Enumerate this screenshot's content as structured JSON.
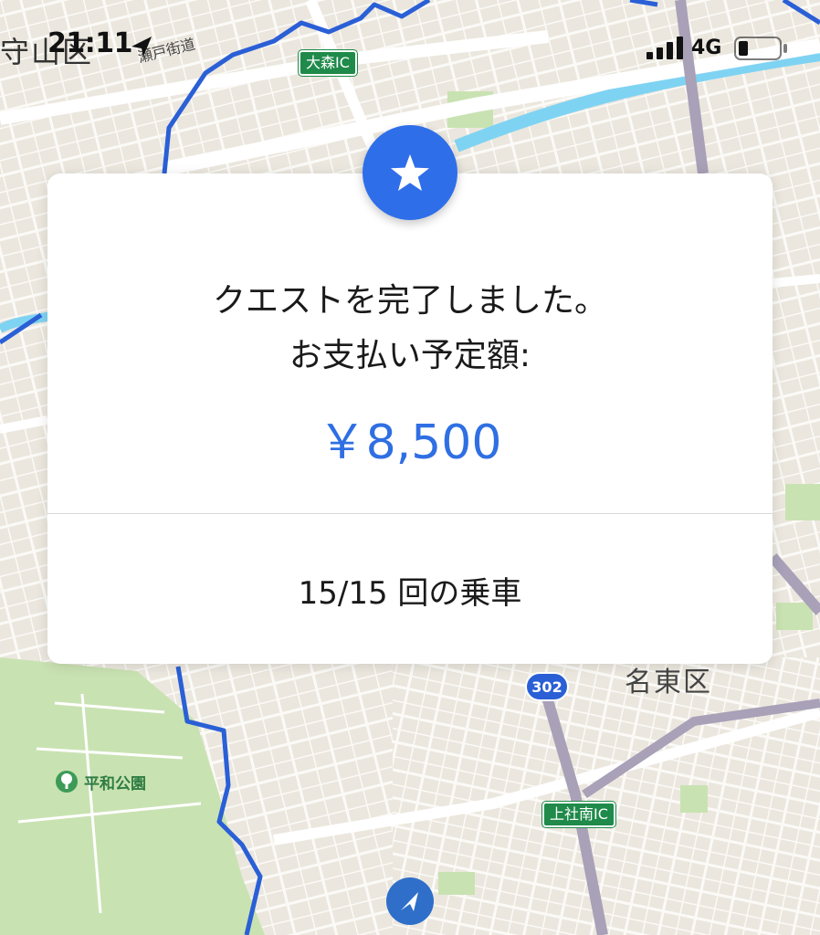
{
  "status_bar": {
    "time": "21:11",
    "network": "4G",
    "icons": [
      "location-arrow-icon",
      "signal-bars-icon",
      "battery-icon"
    ]
  },
  "map": {
    "labels": {
      "district_left": "守山区",
      "street_top": "瀬戸街道",
      "district_right": "名東区",
      "park": "平和公園"
    },
    "ic_signs": {
      "omori": "大森IC",
      "kamiyashiro": "上社南IC"
    },
    "route_number": "302",
    "colors": {
      "background": "#ece8df",
      "park": "#c9e2b2",
      "boundary": "#2a5fd6",
      "water": "#7fd3f2",
      "highway": "#a8a1b8"
    }
  },
  "modal": {
    "badge_icon": "star-icon",
    "message_line1": "クエストを完了しました。",
    "message_line2": "お支払い予定額:",
    "amount": "￥8,500",
    "rides": "15/15 回の乗車",
    "accent_color": "#2f6fe3"
  }
}
